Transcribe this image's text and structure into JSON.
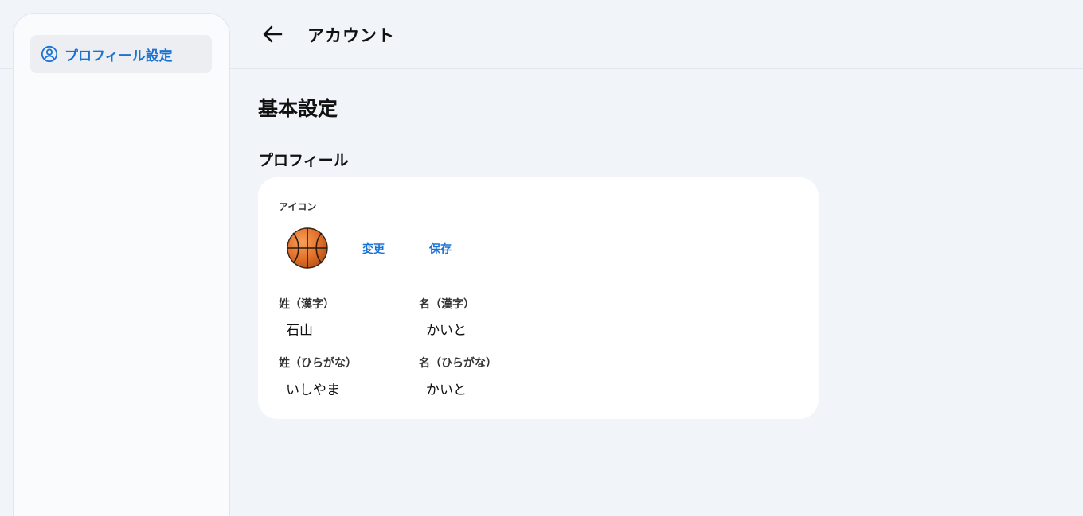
{
  "header": {
    "title": "アカウント",
    "back_icon": "arrow-left-icon"
  },
  "sidebar": {
    "items": [
      {
        "label": "プロフィール設定",
        "icon": "user-circle-icon",
        "active": true
      }
    ]
  },
  "main": {
    "section_title": "基本設定",
    "profile": {
      "title": "プロフィール",
      "icon_caption": "アイコン",
      "avatar": "basketball-icon",
      "change_label": "変更",
      "save_label": "保存",
      "fields": {
        "last_name_kanji": {
          "label": "姓（漢字）",
          "value": "石山"
        },
        "first_name_kanji": {
          "label": "名（漢字）",
          "value": "かいと"
        },
        "last_name_kana": {
          "label": "姓（ひらがな）",
          "value": "いしやま"
        },
        "first_name_kana": {
          "label": "名（ひらがな）",
          "value": "かいと"
        }
      }
    }
  },
  "colors": {
    "accent": "#1a73d4",
    "background": "#f1f4f9",
    "card": "#ffffff",
    "sidebar_active": "#eceef1"
  }
}
